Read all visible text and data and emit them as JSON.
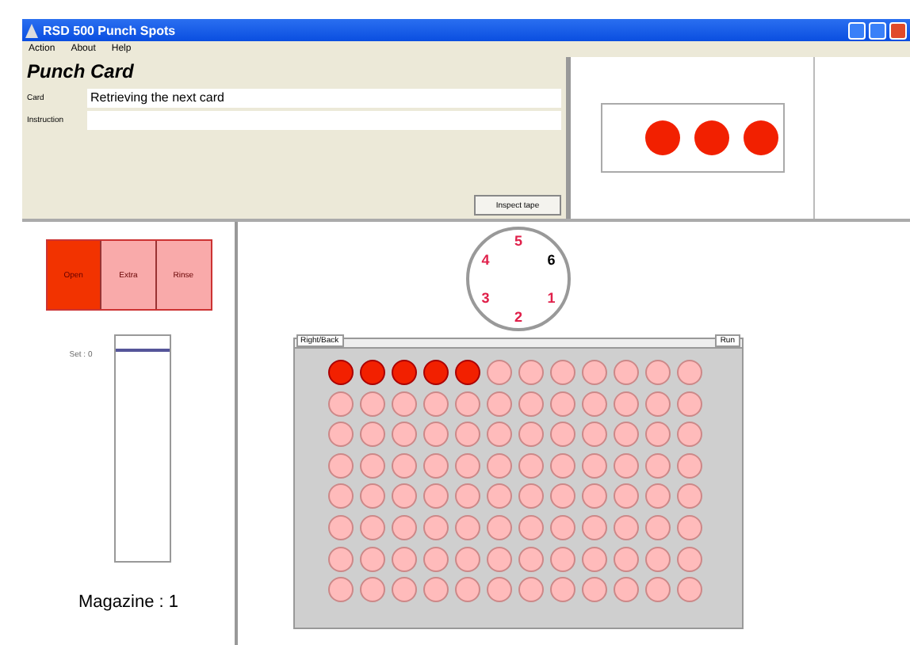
{
  "window": {
    "title": "RSD 500 Punch Spots"
  },
  "menu": [
    "Action",
    "About",
    "Help"
  ],
  "form": {
    "heading": "Punch Card",
    "fields": [
      {
        "label": "Card",
        "value": "Retrieving the next card"
      },
      {
        "label": "Instruction"
      }
    ],
    "button": "Inspect tape"
  },
  "preview": {
    "spots": [
      {
        "kind": "spot"
      },
      {
        "kind": "spot"
      },
      {
        "kind": "spot"
      }
    ]
  },
  "modes": [
    {
      "label": "Open",
      "selected": true
    },
    {
      "label": "Extra",
      "selected": false
    },
    {
      "label": "Rinse",
      "selected": false
    }
  ],
  "magazine": {
    "set_label": "Set : 0",
    "level": 0.93,
    "label": "Magazine : 1"
  },
  "dial": {
    "positions": [
      {
        "label": "5",
        "selected": false
      },
      {
        "label": "6",
        "selected": true
      },
      {
        "label": "1",
        "selected": false
      },
      {
        "label": "2",
        "selected": false
      },
      {
        "label": "3",
        "selected": false
      },
      {
        "label": "4",
        "selected": false
      }
    ]
  },
  "plate": {
    "left_label": "Right/Back",
    "right_label": "Run",
    "rows": [
      {
        "punched": [
          true,
          true,
          true,
          true,
          true,
          false,
          false,
          false,
          false,
          false,
          false,
          false
        ]
      },
      {
        "punched": [
          false,
          false,
          false,
          false,
          false,
          false,
          false,
          false,
          false,
          false,
          false,
          false
        ]
      },
      {
        "punched": [
          false,
          false,
          false,
          false,
          false,
          false,
          false,
          false,
          false,
          false,
          false,
          false
        ]
      },
      {
        "punched": [
          false,
          false,
          false,
          false,
          false,
          false,
          false,
          false,
          false,
          false,
          false,
          false
        ]
      },
      {
        "punched": [
          false,
          false,
          false,
          false,
          false,
          false,
          false,
          false,
          false,
          false,
          false,
          false
        ]
      },
      {
        "punched": [
          false,
          false,
          false,
          false,
          false,
          false,
          false,
          false,
          false,
          false,
          false,
          false
        ]
      },
      {
        "punched": [
          false,
          false,
          false,
          false,
          false,
          false,
          false,
          false,
          false,
          false,
          false,
          false
        ]
      },
      {
        "punched": [
          false,
          false,
          false,
          false,
          false,
          false,
          false,
          false,
          false,
          false,
          false,
          false
        ]
      }
    ]
  }
}
